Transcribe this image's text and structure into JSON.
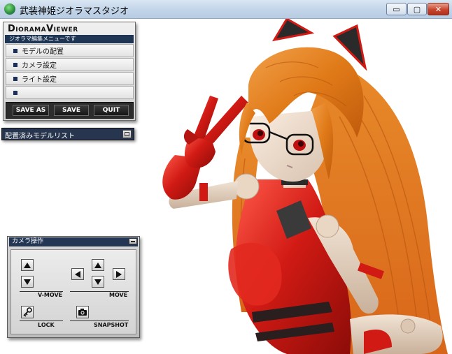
{
  "window": {
    "title": "武装神姫ジオラマスタジオ",
    "min_glyph": "▭",
    "max_glyph": "▢",
    "close_glyph": "✕"
  },
  "diorama_viewer": {
    "title": "DioramaViewer",
    "subtitle": "ジオラマ編集メニューです",
    "menu": [
      "モデルの配置",
      "カメラ設定",
      "ライト設定",
      ""
    ],
    "buttons": {
      "save_as": "SAVE AS",
      "save": "SAVE",
      "quit": "QUIT"
    }
  },
  "model_list": {
    "title": "配置済みモデルリスト"
  },
  "camera_panel": {
    "title": "カメラ操作",
    "labels": {
      "vmove": "V-MOVE",
      "move": "MOVE",
      "lock": "LOCK",
      "snapshot": "SNAPSHOT"
    }
  },
  "colors": {
    "titlebar": "#c2d4e8",
    "panel_dark": "#1f3554",
    "suit_red": "#d11a14",
    "hair_orange": "#e07a18"
  }
}
